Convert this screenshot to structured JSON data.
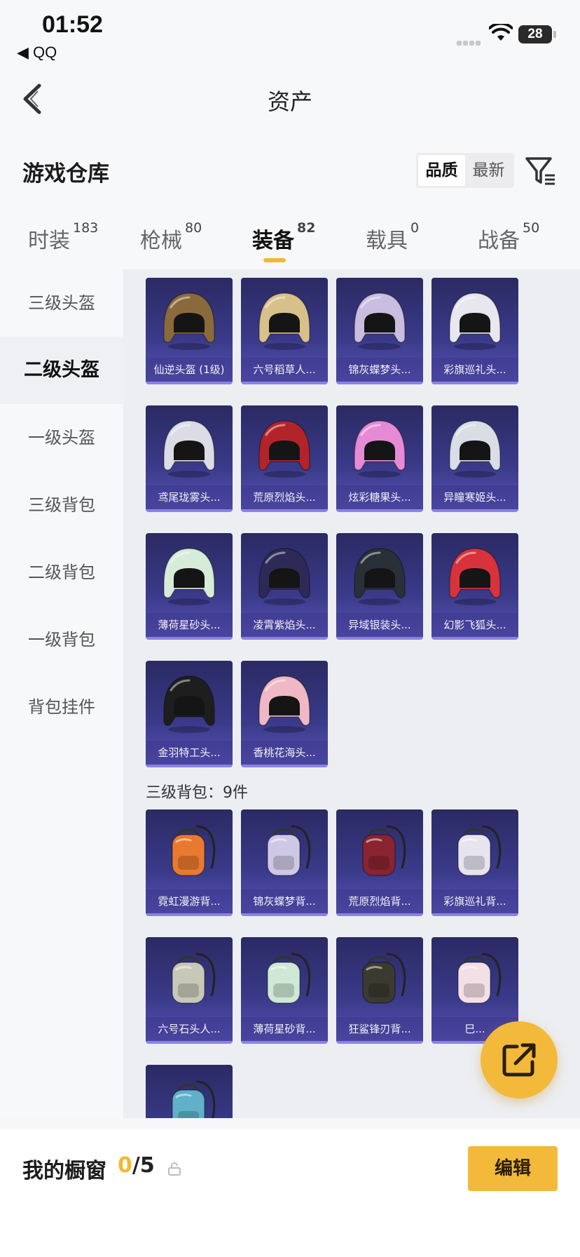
{
  "status_bar": {
    "time": "01:52",
    "back_app": "◀ QQ",
    "battery": "28"
  },
  "nav": {
    "title": "资产"
  },
  "header": {
    "title": "游戏仓库",
    "sort_options": [
      "品质",
      "最新"
    ],
    "active_sort": "品质"
  },
  "tabs": [
    {
      "label": "时装",
      "count": "183"
    },
    {
      "label": "枪械",
      "count": "80"
    },
    {
      "label": "装备",
      "count": "82",
      "active": true
    },
    {
      "label": "载具",
      "count": "0"
    },
    {
      "label": "战备",
      "count": "50"
    }
  ],
  "sidebar": [
    {
      "label": "三级头盔"
    },
    {
      "label": "二级头盔",
      "active": true
    },
    {
      "label": "一级头盔"
    },
    {
      "label": "三级背包"
    },
    {
      "label": "二级背包"
    },
    {
      "label": "一级背包"
    },
    {
      "label": "背包挂件"
    }
  ],
  "helmets": [
    {
      "name": "仙逆头盔 (1级)",
      "color": "#8a6a3c",
      "kind": "helmet"
    },
    {
      "name": "六号稻草人...",
      "color": "#d8c08a",
      "kind": "helmet"
    },
    {
      "name": "锦灰蝶梦头...",
      "color": "#c9bde0",
      "kind": "helmet"
    },
    {
      "name": "彩旗巡礼头...",
      "color": "#e8e6ee",
      "kind": "helmet"
    },
    {
      "name": "鸢尾珑雾头...",
      "color": "#dcdce6",
      "kind": "helmet"
    },
    {
      "name": "荒原烈焰头...",
      "color": "#b3242a",
      "kind": "helmet"
    },
    {
      "name": "炫彩糖果头...",
      "color": "#e68ad6",
      "kind": "helmet"
    },
    {
      "name": "异瞳寒姬头...",
      "color": "#d8dde6",
      "kind": "helmet"
    },
    {
      "name": "薄荷星砂头...",
      "color": "#d6ecd8",
      "kind": "helmet"
    },
    {
      "name": "凌霄紫焰头...",
      "color": "#2e2a58",
      "kind": "helmet"
    },
    {
      "name": "异域银装头...",
      "color": "#2a3038",
      "kind": "helmet"
    },
    {
      "name": "幻影飞狐头...",
      "color": "#d8333c",
      "kind": "helmet"
    },
    {
      "name": "金羽特工头...",
      "color": "#1e1e1e",
      "kind": "helmet"
    },
    {
      "name": "香桃花海头...",
      "color": "#f0b7c4",
      "kind": "helmet"
    }
  ],
  "backpack_group": {
    "title": "三级背包：9件"
  },
  "backpacks": [
    {
      "name": "霓虹漫游背...",
      "color": "#e8792e",
      "kind": "bag"
    },
    {
      "name": "锦灰蝶梦背...",
      "color": "#cfc7e6",
      "kind": "bag"
    },
    {
      "name": "荒原烈焰背...",
      "color": "#8a2430",
      "kind": "bag"
    },
    {
      "name": "彩旗巡礼背...",
      "color": "#e7e4ef",
      "kind": "bag"
    },
    {
      "name": "六号石头人...",
      "color": "#c8c8b8",
      "kind": "bag"
    },
    {
      "name": "薄荷星砂背...",
      "color": "#cfe8d6",
      "kind": "bag"
    },
    {
      "name": "狂鲨锋刃背...",
      "color": "#3a3a30",
      "kind": "bag"
    },
    {
      "name": "巳...",
      "color": "#f3dfe6",
      "kind": "bag"
    },
    {
      "name": "",
      "color": "#5fb0c8",
      "kind": "bag"
    }
  ],
  "bottom": {
    "label": "我的橱窗",
    "used": "0",
    "total": "/5",
    "edit_label": "编辑"
  }
}
